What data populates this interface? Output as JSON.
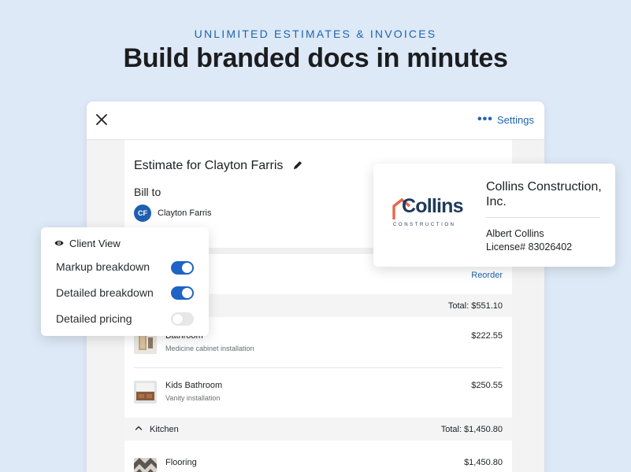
{
  "hero": {
    "eyebrow": "UNLIMITED ESTIMATES & INVOICES",
    "headline": "Build branded docs in minutes"
  },
  "header": {
    "close_icon": "close-icon",
    "more_icon": "more-horizontal-icon",
    "more_label": "•••",
    "settings_label": "Settings"
  },
  "estimate": {
    "title": "Estimate for Clayton Farris",
    "bill_to_label": "Bill to",
    "client_initials": "CF",
    "client_name": "Clayton Farris",
    "reorder_label": "Reorder",
    "sections": [
      {
        "name": "",
        "total": "Total: $551.10",
        "items": [
          {
            "name": "Bathroom",
            "description": "Medicine cabinet installation",
            "price": "$222.55"
          },
          {
            "name": "Kids Bathroom",
            "description": "Vanity installation",
            "price": "$250.55"
          }
        ]
      },
      {
        "name": "Kitchen",
        "total": "Total: $1,450.80",
        "items": [
          {
            "name": "Flooring",
            "description": "",
            "price": "$1,450.80"
          }
        ]
      }
    ]
  },
  "client_view": {
    "title": "Client View",
    "options": [
      {
        "label": "Markup breakdown",
        "enabled": true
      },
      {
        "label": "Detailed breakdown",
        "enabled": true
      },
      {
        "label": "Detailed pricing",
        "enabled": false
      }
    ]
  },
  "company": {
    "logo_word": "Collins",
    "logo_sub": "CONSTRUCTION",
    "name": "Collins Construction, Inc.",
    "person": "Albert Collins",
    "license": "License# 83026402"
  },
  "colors": {
    "accent": "#1f63b0",
    "toggle_on": "#1f63c4",
    "logo_orange": "#e8664a",
    "logo_navy": "#1f3a5a",
    "background": "#dde9f6"
  }
}
